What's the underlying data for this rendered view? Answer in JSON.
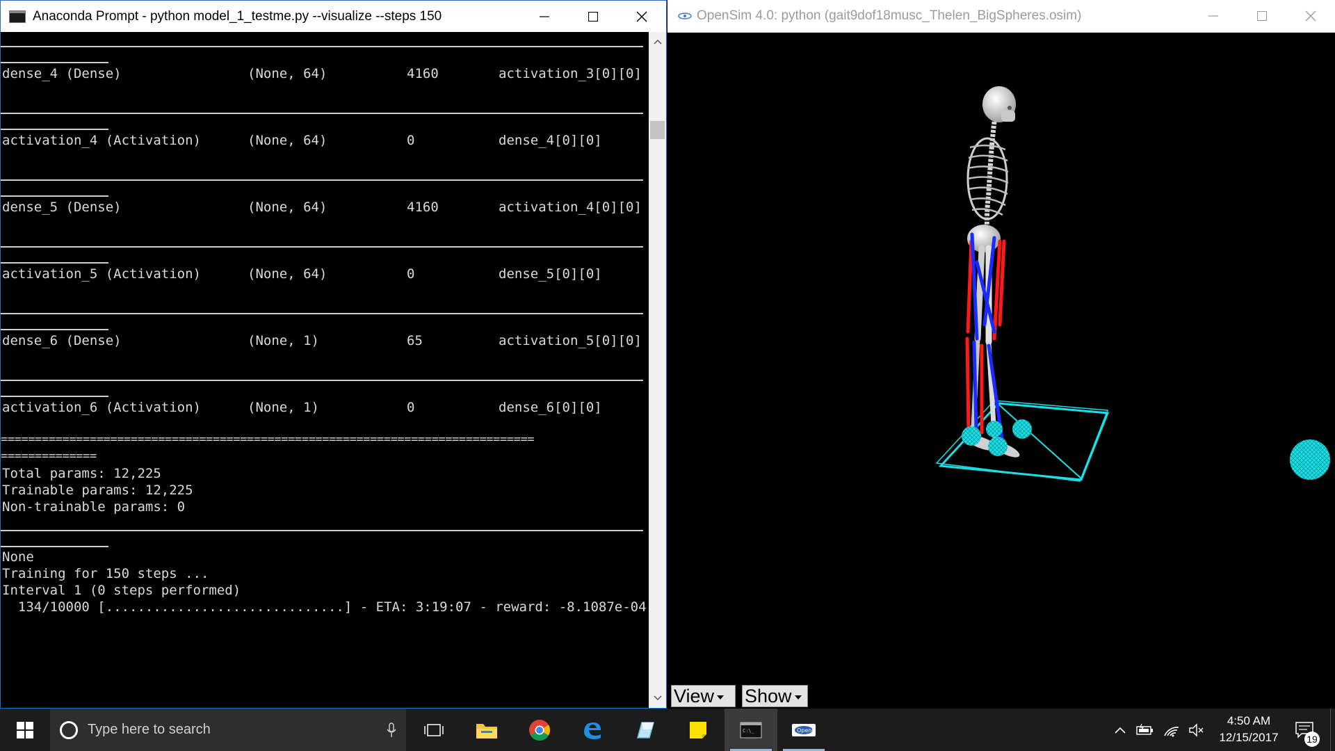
{
  "console": {
    "title": "Anaconda Prompt - python  model_1_testme.py --visualize --steps 150",
    "layers": [
      {
        "name": "dense_4 (Dense)",
        "shape": "(None, 64)",
        "params": "4160",
        "connected": "activation_3[0][0]"
      },
      {
        "name": "activation_4 (Activation)",
        "shape": "(None, 64)",
        "params": "0",
        "connected": "dense_4[0][0]"
      },
      {
        "name": "dense_5 (Dense)",
        "shape": "(None, 64)",
        "params": "4160",
        "connected": "activation_4[0][0]"
      },
      {
        "name": "activation_5 (Activation)",
        "shape": "(None, 64)",
        "params": "0",
        "connected": "dense_5[0][0]"
      },
      {
        "name": "dense_6 (Dense)",
        "shape": "(None, 1)",
        "params": "65",
        "connected": "activation_5[0][0]"
      },
      {
        "name": "activation_6 (Activation)",
        "shape": "(None, 1)",
        "params": "0",
        "connected": "dense_6[0][0]"
      }
    ],
    "separator": "==============================================================================",
    "separator_tail": "==============",
    "total_params": "Total params: 12,225",
    "trainable_params": "Trainable params: 12,225",
    "non_trainable_params": "Non-trainable params: 0",
    "none_line": "None",
    "training_line": "Training for 150 steps ...",
    "interval_line": "Interval 1 (0 steps performed)",
    "progress_line": "  134/10000 [..............................] - ETA: 3:19:07 - reward: -8.1087e-04"
  },
  "opensim": {
    "title": "OpenSim 4.0: python (gait9dof18musc_Thelen_BigSpheres.osim)",
    "view_label": "View",
    "show_label": "Show",
    "colors": {
      "muscle_red": "#ff1a1a",
      "muscle_blue": "#1a2bff",
      "contact": "#19e0e6"
    }
  },
  "taskbar": {
    "search_placeholder": "Type here to search",
    "apps": [
      "task-view",
      "file-explorer",
      "chrome",
      "edge",
      "paint",
      "sticky-notes",
      "console",
      "opensim"
    ],
    "time": "4:50 AM",
    "date": "12/15/2017",
    "notification_count": "19"
  }
}
